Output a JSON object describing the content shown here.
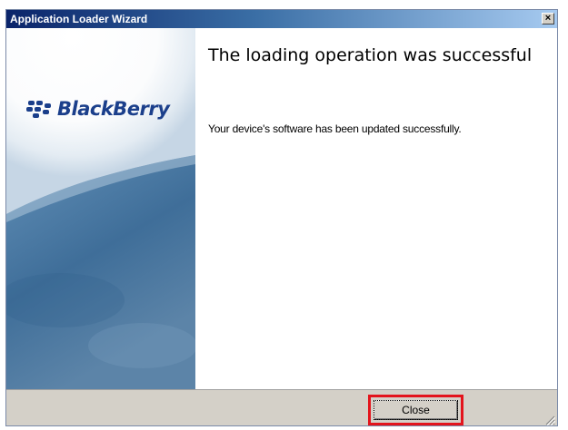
{
  "window": {
    "title": "Application Loader Wizard",
    "close_glyph": "×"
  },
  "sidepanel": {
    "logo_text": "BlackBerry",
    "logo_icon": "blackberry-logo-icon"
  },
  "content": {
    "heading": "The loading operation was successful",
    "message": "Your device's software has been updated successfully."
  },
  "footer": {
    "close_label": "Close"
  },
  "colors": {
    "title_start": "#0a246a",
    "title_end": "#a6caf0",
    "highlight": "#e3141c",
    "panel_blue": "#5b86ad",
    "dialog_gray": "#d4d0c8"
  }
}
